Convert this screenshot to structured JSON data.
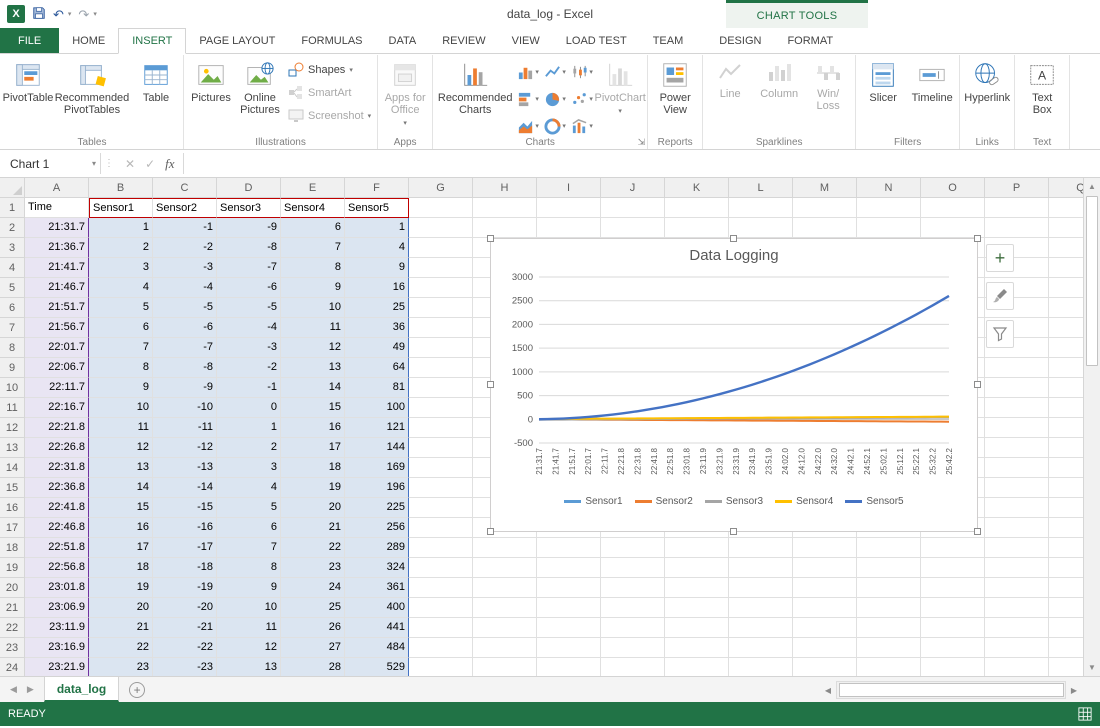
{
  "title_bar": {
    "title": "data_log - Excel",
    "chart_tools_label": "CHART TOOLS"
  },
  "ribbon_tabs": [
    "FILE",
    "HOME",
    "INSERT",
    "PAGE LAYOUT",
    "FORMULAS",
    "DATA",
    "REVIEW",
    "VIEW",
    "LOAD TEST",
    "TEAM",
    "DESIGN",
    "FORMAT"
  ],
  "active_tab": "INSERT",
  "ribbon": {
    "groups": {
      "tables": "Tables",
      "illustrations": "Illustrations",
      "apps": "Apps",
      "charts": "Charts",
      "reports": "Reports",
      "sparklines": "Sparklines",
      "filters": "Filters",
      "links": "Links",
      "text": "Text"
    },
    "buttons": {
      "pivottable": "PivotTable",
      "recommended_pivottables": "Recommended PivotTables",
      "table": "Table",
      "pictures": "Pictures",
      "online_pictures": "Online Pictures",
      "shapes": "Shapes",
      "smartart": "SmartArt",
      "screenshot": "Screenshot",
      "apps_for_office": "Apps for Office",
      "recommended_charts": "Recommended Charts",
      "pivotchart": "PivotChart",
      "power_view": "Power View",
      "spark_line": "Line",
      "spark_column": "Column",
      "win_loss": "Win/ Loss",
      "slicer": "Slicer",
      "timeline": "Timeline",
      "hyperlink": "Hyperlink",
      "text_box": "Text Box"
    }
  },
  "formula_bar": {
    "name_box": "Chart 1",
    "fx_label": "fx",
    "formula_value": ""
  },
  "sheet": {
    "columns": [
      "A",
      "B",
      "C",
      "D",
      "E",
      "F",
      "G",
      "H",
      "I",
      "J",
      "K",
      "L",
      "M",
      "N",
      "O",
      "P",
      "Q"
    ],
    "rows": [
      {
        "n": 1,
        "cells": [
          "Time",
          "Sensor1",
          "Sensor2",
          "Sensor3",
          "Sensor4",
          "Sensor5"
        ]
      },
      {
        "n": 2,
        "cells": [
          "21:31.7",
          "1",
          "-1",
          "-9",
          "6",
          "1"
        ]
      },
      {
        "n": 3,
        "cells": [
          "21:36.7",
          "2",
          "-2",
          "-8",
          "7",
          "4"
        ]
      },
      {
        "n": 4,
        "cells": [
          "21:41.7",
          "3",
          "-3",
          "-7",
          "8",
          "9"
        ]
      },
      {
        "n": 5,
        "cells": [
          "21:46.7",
          "4",
          "-4",
          "-6",
          "9",
          "16"
        ]
      },
      {
        "n": 6,
        "cells": [
          "21:51.7",
          "5",
          "-5",
          "-5",
          "10",
          "25"
        ]
      },
      {
        "n": 7,
        "cells": [
          "21:56.7",
          "6",
          "-6",
          "-4",
          "11",
          "36"
        ]
      },
      {
        "n": 8,
        "cells": [
          "22:01.7",
          "7",
          "-7",
          "-3",
          "12",
          "49"
        ]
      },
      {
        "n": 9,
        "cells": [
          "22:06.7",
          "8",
          "-8",
          "-2",
          "13",
          "64"
        ]
      },
      {
        "n": 10,
        "cells": [
          "22:11.7",
          "9",
          "-9",
          "-1",
          "14",
          "81"
        ]
      },
      {
        "n": 11,
        "cells": [
          "22:16.7",
          "10",
          "-10",
          "0",
          "15",
          "100"
        ]
      },
      {
        "n": 12,
        "cells": [
          "22:21.8",
          "11",
          "-11",
          "1",
          "16",
          "121"
        ]
      },
      {
        "n": 13,
        "cells": [
          "22:26.8",
          "12",
          "-12",
          "2",
          "17",
          "144"
        ]
      },
      {
        "n": 14,
        "cells": [
          "22:31.8",
          "13",
          "-13",
          "3",
          "18",
          "169"
        ]
      },
      {
        "n": 15,
        "cells": [
          "22:36.8",
          "14",
          "-14",
          "4",
          "19",
          "196"
        ]
      },
      {
        "n": 16,
        "cells": [
          "22:41.8",
          "15",
          "-15",
          "5",
          "20",
          "225"
        ]
      },
      {
        "n": 17,
        "cells": [
          "22:46.8",
          "16",
          "-16",
          "6",
          "21",
          "256"
        ]
      },
      {
        "n": 18,
        "cells": [
          "22:51.8",
          "17",
          "-17",
          "7",
          "22",
          "289"
        ]
      },
      {
        "n": 19,
        "cells": [
          "22:56.8",
          "18",
          "-18",
          "8",
          "23",
          "324"
        ]
      },
      {
        "n": 20,
        "cells": [
          "23:01.8",
          "19",
          "-19",
          "9",
          "24",
          "361"
        ]
      },
      {
        "n": 21,
        "cells": [
          "23:06.9",
          "20",
          "-20",
          "10",
          "25",
          "400"
        ]
      },
      {
        "n": 22,
        "cells": [
          "23:11.9",
          "21",
          "-21",
          "11",
          "26",
          "441"
        ]
      },
      {
        "n": 23,
        "cells": [
          "23:16.9",
          "22",
          "-22",
          "12",
          "27",
          "484"
        ]
      },
      {
        "n": 24,
        "cells": [
          "23:21.9",
          "23",
          "-23",
          "13",
          "28",
          "529"
        ]
      }
    ]
  },
  "chart_data": {
    "type": "line",
    "title": "Data Logging",
    "ylim": [
      -500,
      3000
    ],
    "y_ticks": [
      3000,
      2500,
      2000,
      1500,
      1000,
      500,
      0,
      -500
    ],
    "grid": true,
    "legend_position": "bottom",
    "x_tick_labels": [
      "21:31.7",
      "21:41.7",
      "21:51.7",
      "22:01.7",
      "22:11.7",
      "22:21.8",
      "22:31.8",
      "22:41.8",
      "22:51.8",
      "23:01.8",
      "23:11.9",
      "23:21.9",
      "23:31.9",
      "23:41.9",
      "23:51.9",
      "24:02.0",
      "24:12.0",
      "24:22.0",
      "24:32.0",
      "24:42.1",
      "24:52.1",
      "25:02.1",
      "25:12.1",
      "25:22.1",
      "25:32.2",
      "25:42.2"
    ],
    "series": [
      {
        "name": "Sensor1",
        "color": "#5B9BD5",
        "values": [
          1,
          2,
          3,
          4,
          5,
          6,
          7,
          8,
          9,
          10,
          11,
          12,
          13,
          14,
          15,
          16,
          17,
          18,
          19,
          20,
          21,
          22,
          23,
          24,
          25,
          26,
          27,
          28,
          29,
          30,
          31,
          32,
          33,
          34,
          35,
          36,
          37,
          38,
          39,
          40,
          41,
          42,
          43,
          44,
          45,
          46,
          47,
          48,
          49,
          50,
          51
        ]
      },
      {
        "name": "Sensor2",
        "color": "#ED7D31",
        "values": [
          -1,
          -2,
          -3,
          -4,
          -5,
          -6,
          -7,
          -8,
          -9,
          -10,
          -11,
          -12,
          -13,
          -14,
          -15,
          -16,
          -17,
          -18,
          -19,
          -20,
          -21,
          -22,
          -23,
          -24,
          -25,
          -26,
          -27,
          -28,
          -29,
          -30,
          -31,
          -32,
          -33,
          -34,
          -35,
          -36,
          -37,
          -38,
          -39,
          -40,
          -41,
          -42,
          -43,
          -44,
          -45,
          -46,
          -47,
          -48,
          -49,
          -50,
          -51
        ]
      },
      {
        "name": "Sensor3",
        "color": "#A5A5A5",
        "values": [
          -9,
          -8,
          -7,
          -6,
          -5,
          -4,
          -3,
          -2,
          -1,
          0,
          1,
          2,
          3,
          4,
          5,
          6,
          7,
          8,
          9,
          10,
          11,
          12,
          13,
          14,
          15,
          16,
          17,
          18,
          19,
          20,
          21,
          22,
          23,
          24,
          25,
          26,
          27,
          28,
          29,
          30,
          31,
          32,
          33,
          34,
          35,
          36,
          37,
          38,
          39,
          40,
          41
        ]
      },
      {
        "name": "Sensor4",
        "color": "#FFC000",
        "values": [
          6,
          7,
          8,
          9,
          10,
          11,
          12,
          13,
          14,
          15,
          16,
          17,
          18,
          19,
          20,
          21,
          22,
          23,
          24,
          25,
          26,
          27,
          28,
          29,
          30,
          31,
          32,
          33,
          34,
          35,
          36,
          37,
          38,
          39,
          40,
          41,
          42,
          43,
          44,
          45,
          46,
          47,
          48,
          49,
          50,
          51,
          52,
          53,
          54,
          55,
          56
        ]
      },
      {
        "name": "Sensor5",
        "color": "#4472C4",
        "values": [
          1,
          4,
          9,
          16,
          25,
          36,
          49,
          64,
          81,
          100,
          121,
          144,
          169,
          196,
          225,
          256,
          289,
          324,
          361,
          400,
          441,
          484,
          529,
          576,
          625,
          676,
          729,
          784,
          841,
          900,
          961,
          1024,
          1089,
          1156,
          1225,
          1296,
          1369,
          1444,
          1521,
          1600,
          1681,
          1764,
          1849,
          1936,
          2025,
          2116,
          2209,
          2304,
          2401,
          2500,
          2601
        ]
      }
    ]
  },
  "sheet_tab": {
    "name": "data_log"
  },
  "status_bar": {
    "mode": "READY"
  }
}
